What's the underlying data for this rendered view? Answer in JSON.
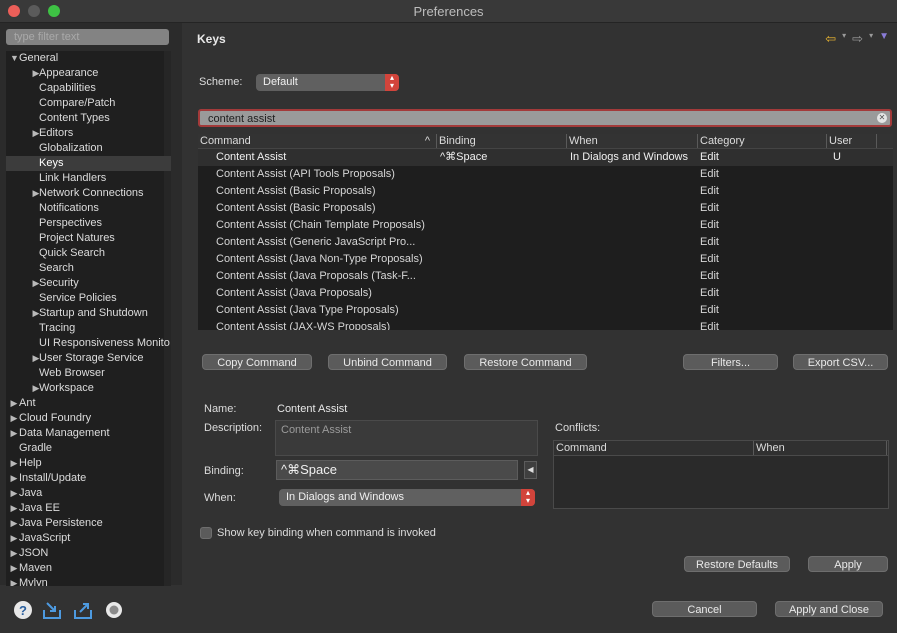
{
  "window": {
    "title": "Preferences"
  },
  "sidebar": {
    "filter_placeholder": "type filter text",
    "items": [
      {
        "label": "General",
        "level": 0,
        "expanded": true
      },
      {
        "label": "Appearance",
        "level": 1,
        "arrow": true
      },
      {
        "label": "Capabilities",
        "level": 1
      },
      {
        "label": "Compare/Patch",
        "level": 1
      },
      {
        "label": "Content Types",
        "level": 1
      },
      {
        "label": "Editors",
        "level": 1,
        "arrow": true
      },
      {
        "label": "Globalization",
        "level": 1
      },
      {
        "label": "Keys",
        "level": 1,
        "selected": true
      },
      {
        "label": "Link Handlers",
        "level": 1
      },
      {
        "label": "Network Connections",
        "level": 1,
        "arrow": true
      },
      {
        "label": "Notifications",
        "level": 1
      },
      {
        "label": "Perspectives",
        "level": 1
      },
      {
        "label": "Project Natures",
        "level": 1
      },
      {
        "label": "Quick Search",
        "level": 1
      },
      {
        "label": "Search",
        "level": 1
      },
      {
        "label": "Security",
        "level": 1,
        "arrow": true
      },
      {
        "label": "Service Policies",
        "level": 1
      },
      {
        "label": "Startup and Shutdown",
        "level": 1,
        "arrow": true
      },
      {
        "label": "Tracing",
        "level": 1
      },
      {
        "label": "UI Responsiveness Monito",
        "level": 1
      },
      {
        "label": "User Storage Service",
        "level": 1,
        "arrow": true
      },
      {
        "label": "Web Browser",
        "level": 1
      },
      {
        "label": "Workspace",
        "level": 1,
        "arrow": true
      },
      {
        "label": "Ant",
        "level": 0,
        "arrow": true
      },
      {
        "label": "Cloud Foundry",
        "level": 0,
        "arrow": true
      },
      {
        "label": "Data Management",
        "level": 0,
        "arrow": true
      },
      {
        "label": "Gradle",
        "level": 0
      },
      {
        "label": "Help",
        "level": 0,
        "arrow": true
      },
      {
        "label": "Install/Update",
        "level": 0,
        "arrow": true
      },
      {
        "label": "Java",
        "level": 0,
        "arrow": true
      },
      {
        "label": "Java EE",
        "level": 0,
        "arrow": true
      },
      {
        "label": "Java Persistence",
        "level": 0,
        "arrow": true
      },
      {
        "label": "JavaScript",
        "level": 0,
        "arrow": true
      },
      {
        "label": "JSON",
        "level": 0,
        "arrow": true
      },
      {
        "label": "Maven",
        "level": 0,
        "arrow": true
      },
      {
        "label": "Mylyn",
        "level": 0,
        "arrow": true
      }
    ]
  },
  "main": {
    "title": "Keys",
    "scheme_label": "Scheme:",
    "scheme_value": "Default",
    "search_value": "content assist",
    "columns": [
      "Command",
      "Binding",
      "When",
      "Category",
      "User"
    ],
    "rows": [
      {
        "command": "Content Assist",
        "binding": "^⌘Space",
        "when": "In Dialogs and Windows",
        "category": "Edit",
        "user": "U",
        "selected": true
      },
      {
        "command": "Content Assist (API Tools Proposals)",
        "binding": "",
        "when": "",
        "category": "Edit",
        "user": ""
      },
      {
        "command": "Content Assist (Basic Proposals)",
        "binding": "",
        "when": "",
        "category": "Edit",
        "user": ""
      },
      {
        "command": "Content Assist (Basic Proposals)",
        "binding": "",
        "when": "",
        "category": "Edit",
        "user": ""
      },
      {
        "command": "Content Assist (Chain Template Proposals)",
        "binding": "",
        "when": "",
        "category": "Edit",
        "user": ""
      },
      {
        "command": "Content Assist (Generic JavaScript Pro...",
        "binding": "",
        "when": "",
        "category": "Edit",
        "user": ""
      },
      {
        "command": "Content Assist (Java Non-Type Proposals)",
        "binding": "",
        "when": "",
        "category": "Edit",
        "user": ""
      },
      {
        "command": "Content Assist (Java Proposals (Task-F...",
        "binding": "",
        "when": "",
        "category": "Edit",
        "user": ""
      },
      {
        "command": "Content Assist (Java Proposals)",
        "binding": "",
        "when": "",
        "category": "Edit",
        "user": ""
      },
      {
        "command": "Content Assist (Java Type Proposals)",
        "binding": "",
        "when": "",
        "category": "Edit",
        "user": ""
      },
      {
        "command": "Content Assist (JAX-WS Proposals)",
        "binding": "",
        "when": "",
        "category": "Edit",
        "user": ""
      }
    ],
    "buttons": {
      "copy": "Copy Command",
      "unbind": "Unbind Command",
      "restore_cmd": "Restore Command",
      "filters": "Filters...",
      "export": "Export CSV..."
    },
    "details": {
      "name_label": "Name:",
      "name_value": "Content Assist",
      "description_label": "Description:",
      "description_value": "Content Assist",
      "binding_label": "Binding:",
      "binding_value": "^⌘Space",
      "when_label": "When:",
      "when_value": "In Dialogs and Windows",
      "conflicts_label": "Conflicts:",
      "conflicts_columns": [
        "Command",
        "When"
      ]
    },
    "show_binding_label": "Show key binding when command is invoked",
    "restore_defaults": "Restore Defaults",
    "apply": "Apply"
  },
  "footer": {
    "cancel": "Cancel",
    "apply_close": "Apply and Close",
    "icons": [
      "help-icon",
      "import-icon",
      "export-icon",
      "record-icon"
    ]
  },
  "colors": {
    "accent_red": "#d2443b",
    "selected_row": "#2f2f2f"
  }
}
